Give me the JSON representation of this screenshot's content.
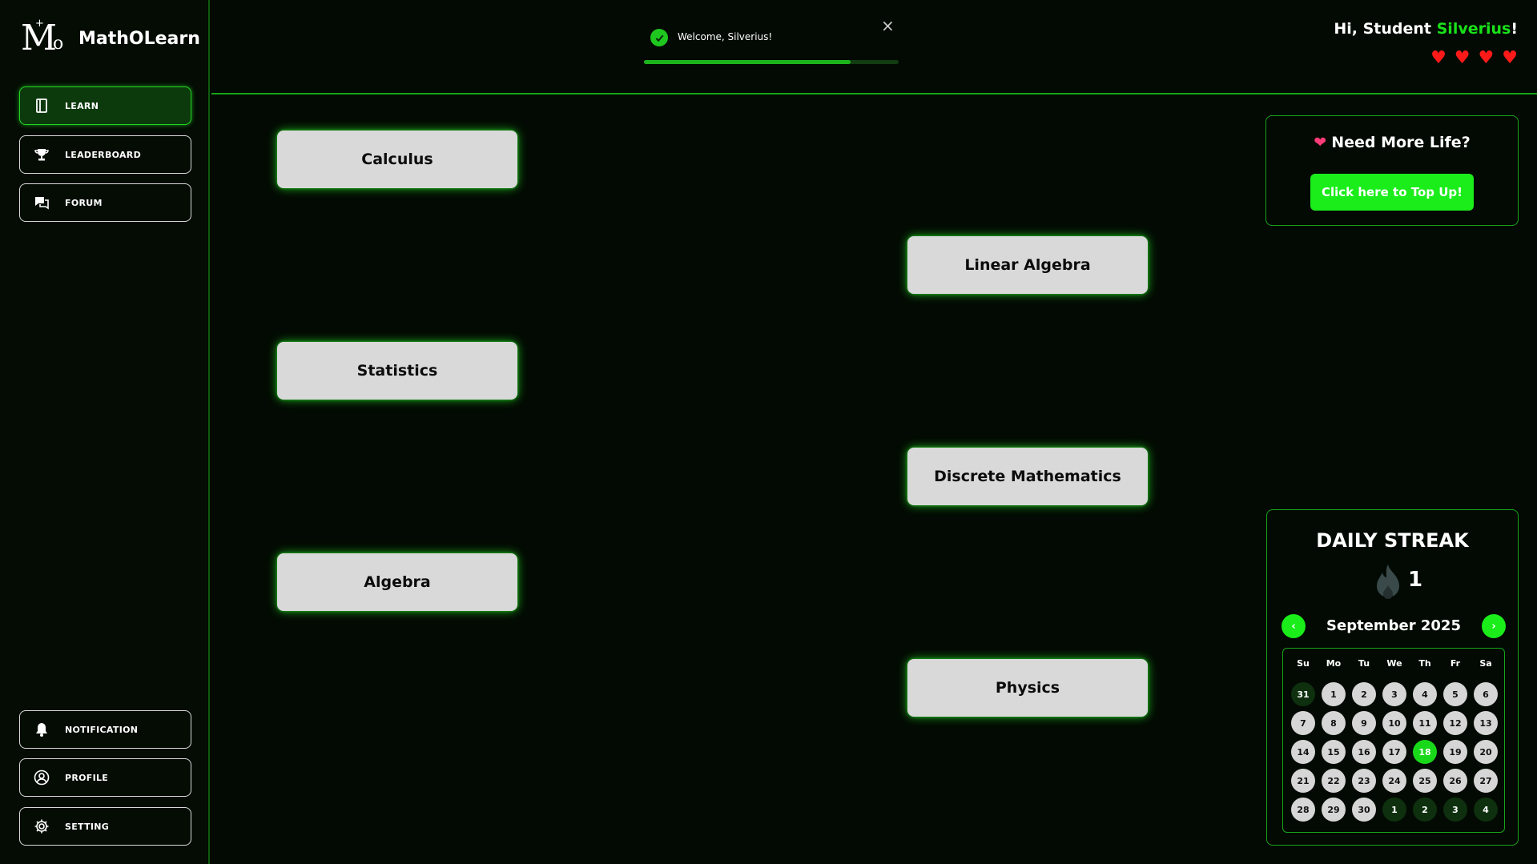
{
  "app": {
    "name": "MathOLearn",
    "logo_letters": "MO"
  },
  "sidebar": {
    "top_items": [
      {
        "label": "LEARN",
        "icon": "book-icon",
        "active": true
      },
      {
        "label": "LEADERBOARD",
        "icon": "trophy-icon",
        "active": false
      },
      {
        "label": "FORUM",
        "icon": "chat-icon",
        "active": false
      }
    ],
    "bottom_items": [
      {
        "label": "NOTIFICATION",
        "icon": "bell-icon"
      },
      {
        "label": "PROFILE",
        "icon": "user-circle-icon"
      },
      {
        "label": "SETTING",
        "icon": "gear-icon"
      }
    ]
  },
  "toast": {
    "message": "Welcome, Silverius!",
    "close": "×",
    "progress_percent": 81
  },
  "header": {
    "greeting_prefix": "Hi, Student ",
    "username": "Silverius",
    "greeting_suffix": "!",
    "lives": 4,
    "heart_color": "#ff1a1a"
  },
  "courses": [
    "Calculus",
    "Linear Algebra",
    "Statistics",
    "Discrete Mathematics",
    "Algebra",
    "Physics"
  ],
  "topup": {
    "title": "Need More Life?",
    "button": "Click here to Top Up!"
  },
  "streak": {
    "title": "DAILY STREAK",
    "count": "1",
    "month": "September 2025",
    "prev": "‹",
    "next": "›",
    "weekdays": [
      "Su",
      "Mo",
      "Tu",
      "We",
      "Th",
      "Fr",
      "Sa"
    ],
    "days": [
      {
        "d": "31",
        "type": "other"
      },
      {
        "d": "1"
      },
      {
        "d": "2"
      },
      {
        "d": "3"
      },
      {
        "d": "4"
      },
      {
        "d": "5"
      },
      {
        "d": "6"
      },
      {
        "d": "7"
      },
      {
        "d": "8"
      },
      {
        "d": "9"
      },
      {
        "d": "10"
      },
      {
        "d": "11"
      },
      {
        "d": "12"
      },
      {
        "d": "13"
      },
      {
        "d": "14"
      },
      {
        "d": "15"
      },
      {
        "d": "16"
      },
      {
        "d": "17"
      },
      {
        "d": "18",
        "type": "today"
      },
      {
        "d": "19"
      },
      {
        "d": "20"
      },
      {
        "d": "21"
      },
      {
        "d": "22"
      },
      {
        "d": "23"
      },
      {
        "d": "24"
      },
      {
        "d": "25"
      },
      {
        "d": "26"
      },
      {
        "d": "27"
      },
      {
        "d": "28"
      },
      {
        "d": "29"
      },
      {
        "d": "30"
      },
      {
        "d": "1",
        "type": "other"
      },
      {
        "d": "2",
        "type": "other"
      },
      {
        "d": "3",
        "type": "other"
      },
      {
        "d": "4",
        "type": "other"
      }
    ]
  },
  "colors": {
    "accent": "#1aed1a",
    "background": "#030a03",
    "card": "#d9d9d9"
  }
}
